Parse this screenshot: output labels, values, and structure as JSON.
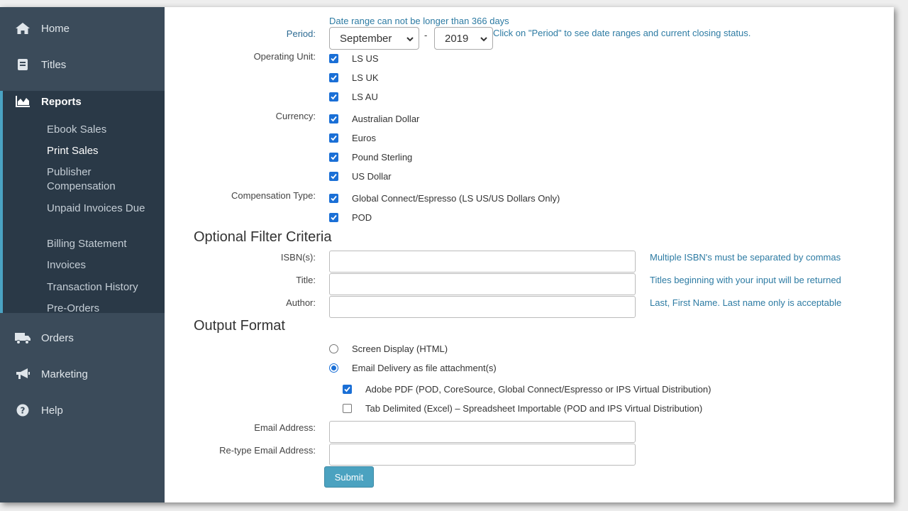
{
  "sidebar": {
    "home": "Home",
    "titles": "Titles",
    "reports": "Reports",
    "reports_items": [
      "Ebook Sales",
      "Print Sales",
      "Publisher Compensation",
      "Unpaid Invoices Due",
      "Billing Statement",
      "Invoices",
      "Transaction History",
      "Pre-Orders"
    ],
    "active_item": "Print Sales",
    "orders": "Orders",
    "marketing": "Marketing",
    "help": "Help"
  },
  "form": {
    "date_range_note": "Date range can not be longer than 366 days",
    "period_label": "Period:",
    "period_month": "September",
    "period_sep": "-",
    "period_year": "2019",
    "period_hint": "Click on \"Period\" to see date ranges and current closing status.",
    "operating_unit_label": "Operating Unit:",
    "operating_units": [
      "LS US",
      "LS UK",
      "LS AU"
    ],
    "currency_label": "Currency:",
    "currencies": [
      "Australian Dollar",
      "Euros",
      "Pound Sterling",
      "US Dollar"
    ],
    "compensation_label": "Compensation Type:",
    "compensation_types": [
      "Global Connect/Espresso (LS US/US Dollars Only)",
      "POD"
    ],
    "optional_heading": "Optional Filter Criteria",
    "isbn_label": "ISBN(s):",
    "isbn_hint": "Multiple ISBN's must be separated by commas",
    "title_label": "Title:",
    "title_hint": "Titles beginning with your input will be returned",
    "author_label": "Author:",
    "author_hint": "Last, First Name. Last name only is acceptable",
    "output_heading": "Output Format",
    "output_screen": "Screen Display (HTML)",
    "output_email": "Email Delivery as file attachment(s)",
    "format_pdf": "Adobe PDF (POD, CoreSource, Global Connect/Espresso or IPS Virtual Distribution)",
    "format_tab": "Tab Delimited (Excel) – Spreadsheet Importable (POD and IPS Virtual Distribution)",
    "email_label": "Email Address:",
    "retype_email_label": "Re-type Email Address:",
    "submit": "Submit"
  }
}
